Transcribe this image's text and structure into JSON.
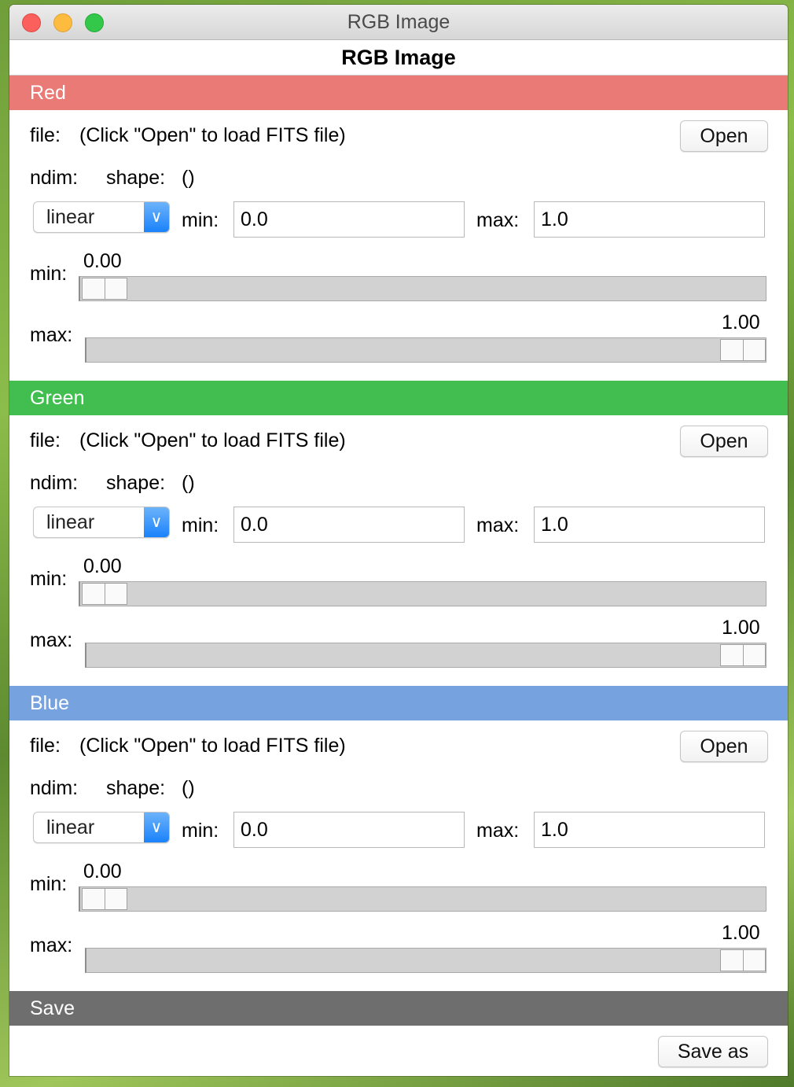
{
  "window": {
    "title": "RGB Image"
  },
  "header": {
    "title": "RGB Image"
  },
  "channels": [
    {
      "name": "Red",
      "color": "#e97a75",
      "file_label": "file:",
      "file_value": "(Click \"Open\" to load FITS file)",
      "open_label": "Open",
      "ndim_label": "ndim:",
      "shape_label": "shape:",
      "shape_value": "()",
      "stretch": "linear",
      "min_label": "min:",
      "min_value": "0.0",
      "max_label": "max:",
      "max_value": "1.0",
      "slider_min_label": "min:",
      "slider_min_value": "0.00",
      "slider_max_label": "max:",
      "slider_max_value": "1.00"
    },
    {
      "name": "Green",
      "color": "#42bd4f",
      "file_label": "file:",
      "file_value": "(Click \"Open\" to load FITS file)",
      "open_label": "Open",
      "ndim_label": "ndim:",
      "shape_label": "shape:",
      "shape_value": "()",
      "stretch": "linear",
      "min_label": "min:",
      "min_value": "0.0",
      "max_label": "max:",
      "max_value": "1.0",
      "slider_min_label": "min:",
      "slider_min_value": "0.00",
      "slider_max_label": "max:",
      "slider_max_value": "1.00"
    },
    {
      "name": "Blue",
      "color": "#76a3e0",
      "file_label": "file:",
      "file_value": "(Click \"Open\" to load FITS file)",
      "open_label": "Open",
      "ndim_label": "ndim:",
      "shape_label": "shape:",
      "shape_value": "()",
      "stretch": "linear",
      "min_label": "min:",
      "min_value": "0.0",
      "max_label": "max:",
      "max_value": "1.0",
      "slider_min_label": "min:",
      "slider_min_value": "0.00",
      "slider_max_label": "max:",
      "slider_max_value": "1.00"
    }
  ],
  "save": {
    "title": "Save",
    "color": "#6e6e6e",
    "save_as_label": "Save as"
  }
}
